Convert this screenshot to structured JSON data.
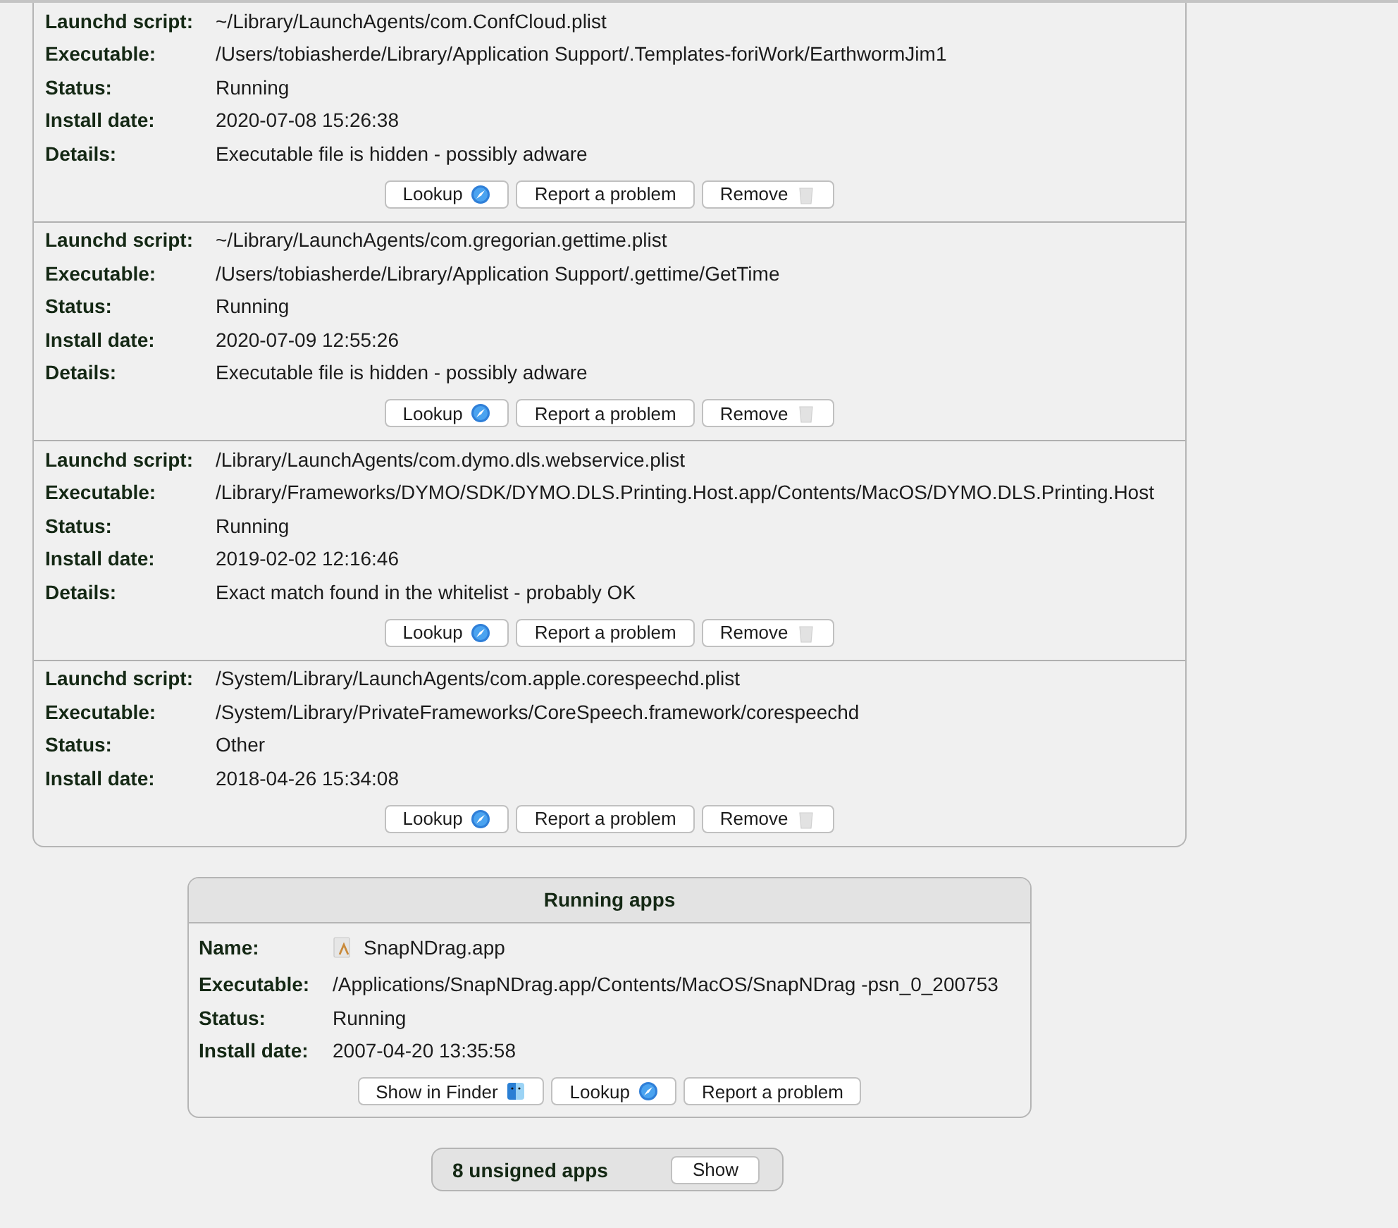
{
  "launch_items": [
    {
      "fields": [
        {
          "label": "Launchd script:",
          "value": "~/Library/LaunchAgents/com.ConfCloud.plist"
        },
        {
          "label": "Executable:",
          "value": "/Users/tobiasherde/Library/Application Support/.Templates-foriWork/EarthwormJim1"
        },
        {
          "label": "Status:",
          "value": "Running"
        },
        {
          "label": "Install date:",
          "value": "2020-07-08 15:26:38"
        },
        {
          "label": "Details:",
          "value": "Executable file is hidden - possibly adware"
        }
      ],
      "buttons": [
        {
          "label": "Lookup",
          "kind": "lookup"
        },
        {
          "label": "Report a problem",
          "kind": "plain"
        },
        {
          "label": "Remove",
          "kind": "remove"
        }
      ]
    },
    {
      "fields": [
        {
          "label": "Launchd script:",
          "value": "~/Library/LaunchAgents/com.gregorian.gettime.plist"
        },
        {
          "label": "Executable:",
          "value": "/Users/tobiasherde/Library/Application Support/.gettime/GetTime"
        },
        {
          "label": "Status:",
          "value": "Running"
        },
        {
          "label": "Install date:",
          "value": "2020-07-09 12:55:26"
        },
        {
          "label": "Details:",
          "value": "Executable file is hidden - possibly adware"
        }
      ],
      "buttons": [
        {
          "label": "Lookup",
          "kind": "lookup"
        },
        {
          "label": "Report a problem",
          "kind": "plain"
        },
        {
          "label": "Remove",
          "kind": "remove"
        }
      ]
    },
    {
      "fields": [
        {
          "label": "Launchd script:",
          "value": "/Library/LaunchAgents/com.dymo.dls.webservice.plist"
        },
        {
          "label": "Executable:",
          "value": "/Library/Frameworks/DYMO/SDK/DYMO.DLS.Printing.Host.app/Contents/MacOS/DYMO.DLS.Printing.Host"
        },
        {
          "label": "Status:",
          "value": "Running"
        },
        {
          "label": "Install date:",
          "value": "2019-02-02 12:16:46"
        },
        {
          "label": "Details:",
          "value": "Exact match found in the whitelist - probably OK"
        }
      ],
      "buttons": [
        {
          "label": "Lookup",
          "kind": "lookup"
        },
        {
          "label": "Report a problem",
          "kind": "plain"
        },
        {
          "label": "Remove",
          "kind": "remove"
        }
      ]
    },
    {
      "fields": [
        {
          "label": "Launchd script:",
          "value": "/System/Library/LaunchAgents/com.apple.corespeechd.plist"
        },
        {
          "label": "Executable:",
          "value": "/System/Library/PrivateFrameworks/CoreSpeech.framework/corespeechd"
        },
        {
          "label": "Status:",
          "value": "Other"
        },
        {
          "label": "Install date:",
          "value": "2018-04-26 15:34:08"
        }
      ],
      "buttons": [
        {
          "label": "Lookup",
          "kind": "lookup"
        },
        {
          "label": "Report a problem",
          "kind": "plain"
        },
        {
          "label": "Remove",
          "kind": "remove"
        }
      ]
    }
  ],
  "running_apps": {
    "title": "Running apps",
    "fields": [
      {
        "label": "Name:",
        "value": "SnapNDrag.app",
        "kind": "app"
      },
      {
        "label": "Executable:",
        "value": "/Applications/SnapNDrag.app/Contents/MacOS/SnapNDrag -psn_0_200753",
        "kind": "text"
      },
      {
        "label": "Status:",
        "value": "Running",
        "kind": "text"
      },
      {
        "label": "Install date:",
        "value": "2007-04-20 13:35:58",
        "kind": "text"
      }
    ],
    "buttons": [
      {
        "label": "Show in Finder",
        "kind": "finder"
      },
      {
        "label": "Lookup",
        "kind": "lookup"
      },
      {
        "label": "Report a problem",
        "kind": "plain"
      }
    ]
  },
  "unsigned": {
    "label": "8 unsigned apps",
    "button": "Show"
  }
}
